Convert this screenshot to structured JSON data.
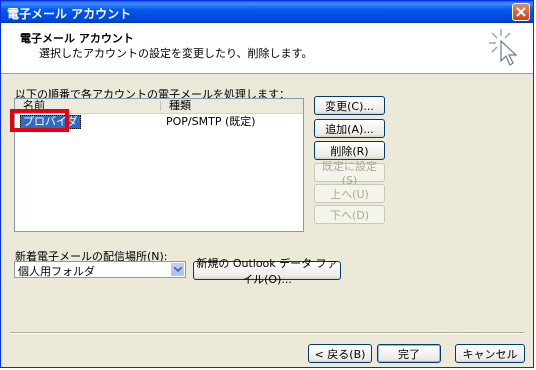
{
  "window": {
    "title": "電子メール アカウント"
  },
  "header": {
    "title": "電子メール アカウント",
    "description": "選択したアカウントの設定を変更したり、削除します。"
  },
  "accounts": {
    "label": "以下の順番で各アカウントの電子メールを処理します：",
    "columns": [
      "名前",
      "種類"
    ],
    "rows": [
      {
        "name": "プロバイダ",
        "type": "POP/SMTP (既定)"
      }
    ]
  },
  "side_buttons": {
    "change": "変更(C)...",
    "add": "追加(A)...",
    "remove": "削除(R)",
    "set_default": "既定に設定(S)",
    "move_up": "上へ(U)",
    "move_down": "下へ(D)"
  },
  "delivery": {
    "label": "新着電子メールの配信場所(N):",
    "selected": "個人用フォルダ",
    "new_data_file_button": "新規の Outlook データ ファイル(O)..."
  },
  "footer": {
    "back": "< 戻る(B)",
    "finish": "完了",
    "cancel": "キャンセル"
  },
  "icons": [
    "close-icon",
    "wizard-sparkle-icon",
    "dropdown-arrow-icon"
  ],
  "colors": {
    "titlebar": "#0058EE",
    "selection": "#316AC5",
    "highlight_box": "#E8000F"
  }
}
